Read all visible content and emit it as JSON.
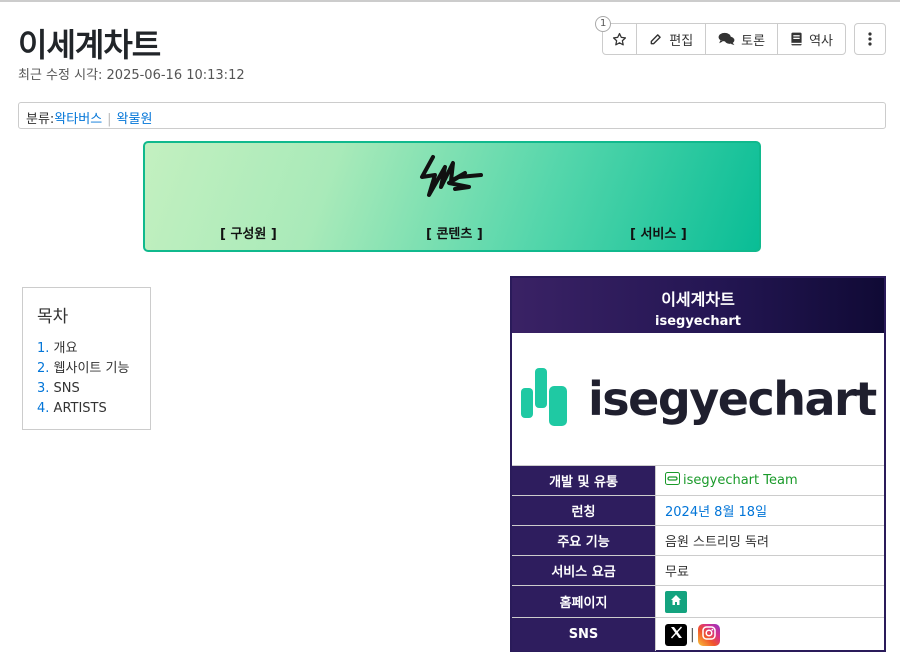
{
  "page": {
    "title": "이세계차트",
    "last_modified": "최근 수정 시각: 2025-06-16 10:13:12"
  },
  "actions": {
    "star_count": "1",
    "edit_label": "편집",
    "discuss_label": "토론",
    "history_label": "역사"
  },
  "category": {
    "prefix": "분류:",
    "items": [
      "왁타버스",
      "왁물원"
    ]
  },
  "banner": {
    "links": [
      "[ 구성원 ]",
      "[ 콘텐츠 ]",
      "[ 서비스 ]"
    ]
  },
  "toc": {
    "title": "목차",
    "items": [
      {
        "num": "1.",
        "label": "개요"
      },
      {
        "num": "2.",
        "label": "웹사이트 기능"
      },
      {
        "num": "3.",
        "label": "SNS"
      },
      {
        "num": "4.",
        "label": "ARTISTS"
      }
    ]
  },
  "infobox": {
    "name": "이세계차트",
    "subtitle": "isegyechart",
    "logo_text": "isegyechart",
    "rows": [
      {
        "key": "개발 및 유통",
        "value": "isegyechart Team"
      },
      {
        "key": "런칭",
        "value": "2024년 8월 18일"
      },
      {
        "key": "주요 기능",
        "value": "음원 스트리밍 독려"
      },
      {
        "key": "서비스 요금",
        "value": "무료"
      },
      {
        "key": "홈페이지",
        "value": ""
      },
      {
        "key": "SNS",
        "value": "|"
      }
    ]
  },
  "colors": {
    "accent_teal": "#10b98d",
    "infobox_dark": "#2e1d5e",
    "link_blue": "#0275d8",
    "link_green": "#1a9a2a"
  },
  "icons": [
    "star-icon",
    "edit-icon",
    "chat-icon",
    "book-icon",
    "more-vertical-icon",
    "link-icon",
    "home-icon",
    "x-logo-icon",
    "instagram-icon"
  ]
}
